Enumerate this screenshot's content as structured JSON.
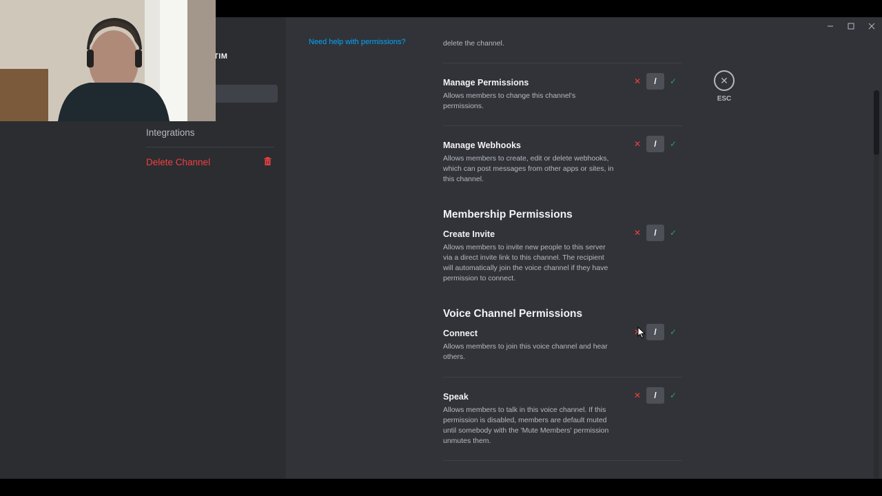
{
  "window": {
    "controls": [
      "minimize-icon",
      "maximize-icon",
      "close-icon"
    ]
  },
  "sidebar": {
    "server_title_fragment": "TIM",
    "items": [
      {
        "label": "Integrations"
      },
      {
        "label": "Delete Channel",
        "icon": "trash-icon",
        "color": "#f23f42"
      }
    ]
  },
  "help_link": "Need help with permissions?",
  "esc": {
    "label": "ESC"
  },
  "top_cut_text": "delete the channel.",
  "permissions": [
    {
      "title": "Manage Permissions",
      "description": "Allows members to change this channel's permissions."
    },
    {
      "title": "Manage Webhooks",
      "description": "Allows members to create, edit or delete webhooks, which can post messages from other apps or sites, in this channel."
    }
  ],
  "sections": [
    {
      "heading": "Membership Permissions",
      "permissions": [
        {
          "title": "Create Invite",
          "description": "Allows members to invite new people to this server via a direct invite link to this channel. The recipient will automatically join the voice channel if they have permission to connect."
        }
      ]
    },
    {
      "heading": "Voice Channel Permissions",
      "permissions": [
        {
          "title": "Connect",
          "description": "Allows members to join this voice channel and hear others."
        },
        {
          "title": "Speak",
          "description": "Allows members to talk in this voice channel. If this permission is disabled, members are default muted until somebody with the 'Mute Members' permission unmutes them."
        }
      ]
    }
  ],
  "toggle": {
    "deny": "✕",
    "neutral": "/",
    "allow": "✓",
    "selected": "neutral"
  },
  "colors": {
    "deny": "#f23f42",
    "allow": "#23a559",
    "link": "#00a8fc",
    "background": "#313338",
    "sidebar": "#2b2d31"
  }
}
